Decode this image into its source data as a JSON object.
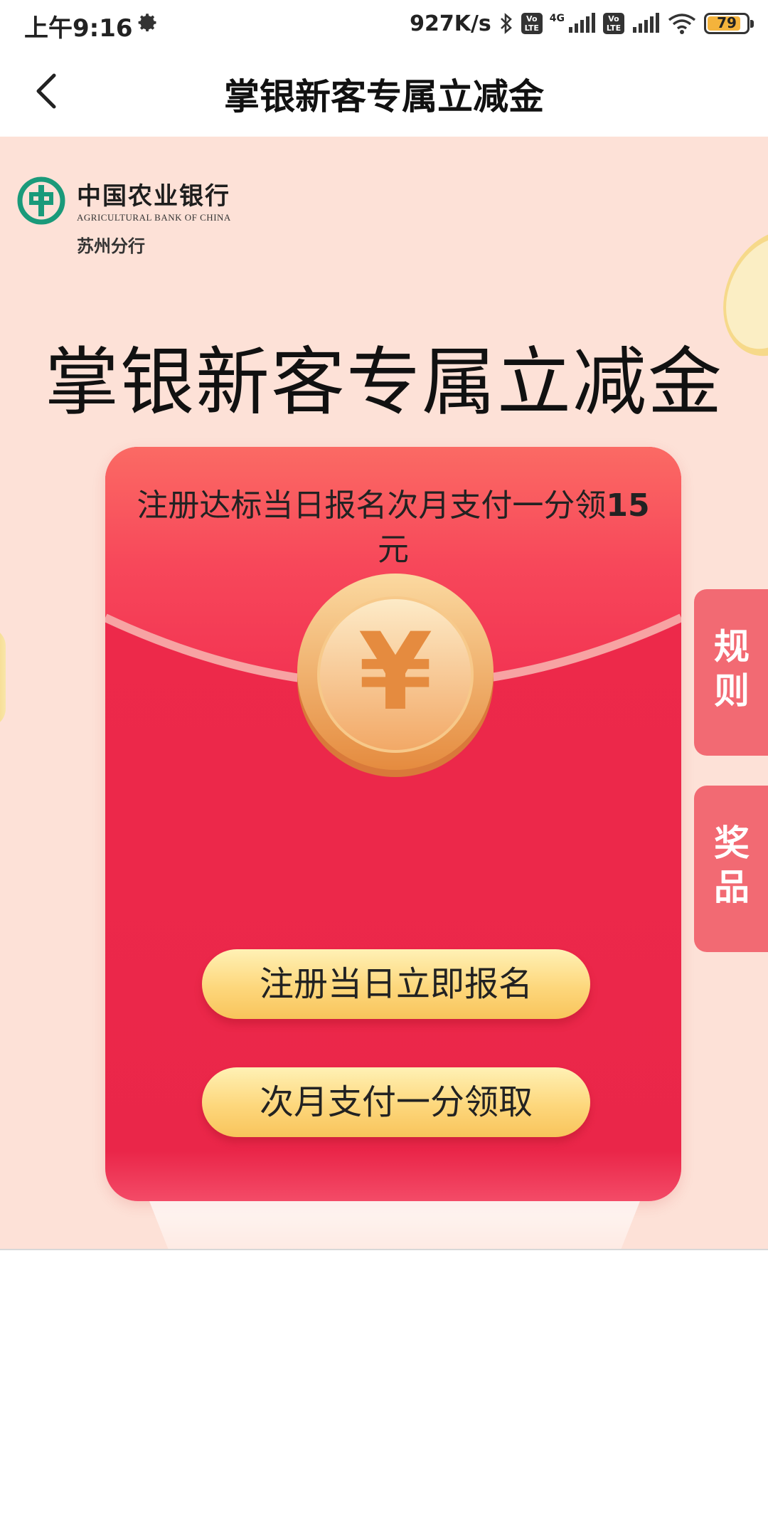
{
  "status_bar": {
    "time": "上午9:16",
    "net_speed": "927K/s",
    "volte_label": "Vo LTE",
    "network_label": "4G",
    "battery_level": "79",
    "icons": [
      "gear-icon",
      "bluetooth-icon",
      "volte-icon",
      "signal-icon",
      "wifi-icon",
      "battery-icon"
    ]
  },
  "nav": {
    "title": "掌银新客专属立减金",
    "back_icon": "chevron-left-icon"
  },
  "brand": {
    "name_cn": "中国农业银行",
    "name_en": "AGRICULTURAL BANK OF CHINA",
    "branch": "苏州分行"
  },
  "banner": {
    "headline": "掌银新客专属立减金"
  },
  "envelope": {
    "description_prefix": "注册达标当日报名次月支付一分领",
    "description_amount": "15",
    "description_suffix": "元",
    "coin_symbol": "¥",
    "register_button": "注册当日立即报名",
    "pay_button": "次月支付一分领取"
  },
  "side_tabs": {
    "rules": "规则",
    "prizes": "奖品"
  },
  "colors": {
    "banner_bg": "#fde1d7",
    "envelope_red": "#ec2a4b",
    "button_gold": "#fdd77c",
    "side_tab": "#f26a73",
    "abc_green": "#1a9a7a"
  }
}
